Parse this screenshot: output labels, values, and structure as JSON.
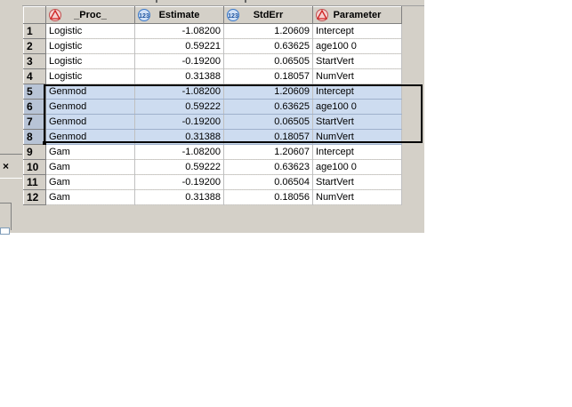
{
  "columns": [
    {
      "label": "_Proc_",
      "type_icon": "char-type-icon"
    },
    {
      "label": "Estimate",
      "type_icon": "numeric-type-icon"
    },
    {
      "label": "StdErr",
      "type_icon": "numeric-type-icon"
    },
    {
      "label": "Parameter",
      "type_icon": "char-type-icon"
    }
  ],
  "rows": [
    {
      "n": "1",
      "proc": "Logistic",
      "estimate": "-1.08200",
      "stderr": "1.20609",
      "parameter": "Intercept",
      "selected": false
    },
    {
      "n": "2",
      "proc": "Logistic",
      "estimate": "0.59221",
      "stderr": "0.63625",
      "parameter": "age100 0",
      "selected": false
    },
    {
      "n": "3",
      "proc": "Logistic",
      "estimate": "-0.19200",
      "stderr": "0.06505",
      "parameter": "StartVert",
      "selected": false
    },
    {
      "n": "4",
      "proc": "Logistic",
      "estimate": "0.31388",
      "stderr": "0.18057",
      "parameter": "NumVert",
      "selected": false
    },
    {
      "n": "5",
      "proc": "Genmod",
      "estimate": "-1.08200",
      "stderr": "1.20609",
      "parameter": "Intercept",
      "selected": true
    },
    {
      "n": "6",
      "proc": "Genmod",
      "estimate": "0.59222",
      "stderr": "0.63625",
      "parameter": "age100 0",
      "selected": true
    },
    {
      "n": "7",
      "proc": "Genmod",
      "estimate": "-0.19200",
      "stderr": "0.06505",
      "parameter": "StartVert",
      "selected": true
    },
    {
      "n": "8",
      "proc": "Genmod",
      "estimate": "0.31388",
      "stderr": "0.18057",
      "parameter": "NumVert",
      "selected": true
    },
    {
      "n": "9",
      "proc": "Gam",
      "estimate": "-1.08200",
      "stderr": "1.20607",
      "parameter": "Intercept",
      "selected": false
    },
    {
      "n": "10",
      "proc": "Gam",
      "estimate": "0.59222",
      "stderr": "0.63623",
      "parameter": "age100 0",
      "selected": false
    },
    {
      "n": "11",
      "proc": "Gam",
      "estimate": "-0.19200",
      "stderr": "0.06504",
      "parameter": "StartVert",
      "selected": false
    },
    {
      "n": "12",
      "proc": "Gam",
      "estimate": "0.31388",
      "stderr": "0.18056",
      "parameter": "NumVert",
      "selected": false
    }
  ],
  "left_panel": {
    "close_glyph": "×"
  },
  "colors": {
    "selection": "#cddcf0",
    "frame": "#d4d0c8",
    "char_icon": "#e03030",
    "num_icon": "#3a78c8"
  }
}
